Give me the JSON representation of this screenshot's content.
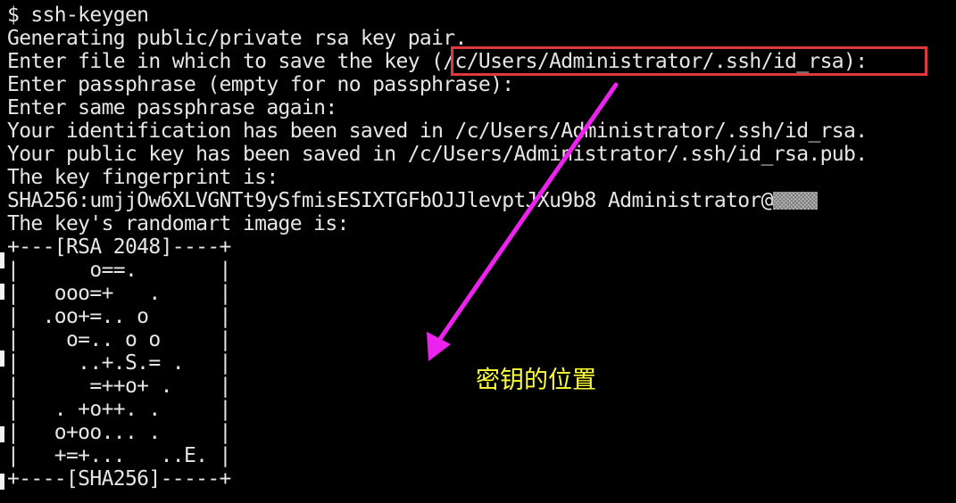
{
  "terminal": {
    "lines": [
      "$ ssh-keygen",
      "Generating public/private rsa key pair.",
      "Enter file in which to save the key (/c/Users/Administrator/.ssh/id_rsa):",
      "Enter passphrase (empty for no passphrase):",
      "Enter same passphrase again:",
      "Your identification has been saved in /c/Users/Administrator/.ssh/id_rsa.",
      "Your public key has been saved in /c/Users/Administrator/.ssh/id_rsa.pub.",
      "The key fingerprint is:",
      "SHA256:umjjOw6XLVGNTt9ySfmisESIXTGFbOJJlevptJXu9b8 Administrator@",
      "The key's randomart image is:",
      "+---[RSA 2048]----+",
      "|      o==.       |",
      "|   ooo=+   .     |",
      "|  .oo+=.. o      |",
      "|    o=.. o o     |",
      "|     ..+.S.= .   |",
      "|      =++o+ .    |",
      "|   . +o++. .     |",
      "|   o+oo... .     |",
      "|   +=+...   ..E. |",
      "+----[SHA256]-----+"
    ]
  },
  "annotation": {
    "label": "密钥的位置",
    "box_color": "#e0383f",
    "arrow_color": "#ee22ee",
    "label_color": "#ffff33"
  }
}
